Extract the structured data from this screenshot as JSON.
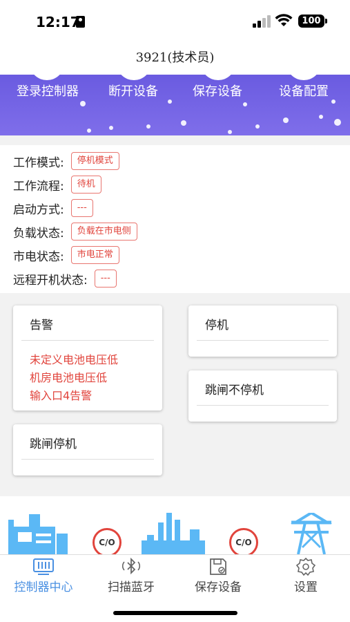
{
  "status_bar": {
    "time": "12:17",
    "battery": "100"
  },
  "header": {
    "title": "3921(技术员)"
  },
  "toolbar": {
    "login_label": "登录控制器",
    "disconnect_label": "断开设备",
    "save_label": "保存设备",
    "config_label": "设备配置"
  },
  "info": {
    "rows": [
      {
        "label": "工作模式:",
        "value": "停机模式"
      },
      {
        "label": "工作流程:",
        "value": "待机"
      },
      {
        "label": "启动方式:",
        "value": "---"
      },
      {
        "label": "负载状态:",
        "value": "负载在市电侧"
      },
      {
        "label": "市电状态:",
        "value": "市电正常"
      },
      {
        "label": "远程开机状态:",
        "value": "---"
      }
    ]
  },
  "cards": {
    "alarm": {
      "title": "告警",
      "items": [
        "未定义电池电压低",
        "机房电池电压低",
        "输入口4告警"
      ]
    },
    "stop": {
      "title": "停机"
    },
    "trip_no_stop": {
      "title": "跳闸不停机"
    },
    "trip_stop": {
      "title": "跳闸停机"
    }
  },
  "diagram": {
    "breaker_1": "C/O",
    "breaker_2": "C/O"
  },
  "tabs": [
    {
      "label": "控制器中心"
    },
    {
      "label": "扫描蓝牙"
    },
    {
      "label": "保存设备"
    },
    {
      "label": "设置"
    }
  ],
  "colors": {
    "accent": "#4a90e2",
    "toolbar": "#7062e6",
    "alarm": "#e1443c",
    "diagram": "#5bb8f5"
  }
}
